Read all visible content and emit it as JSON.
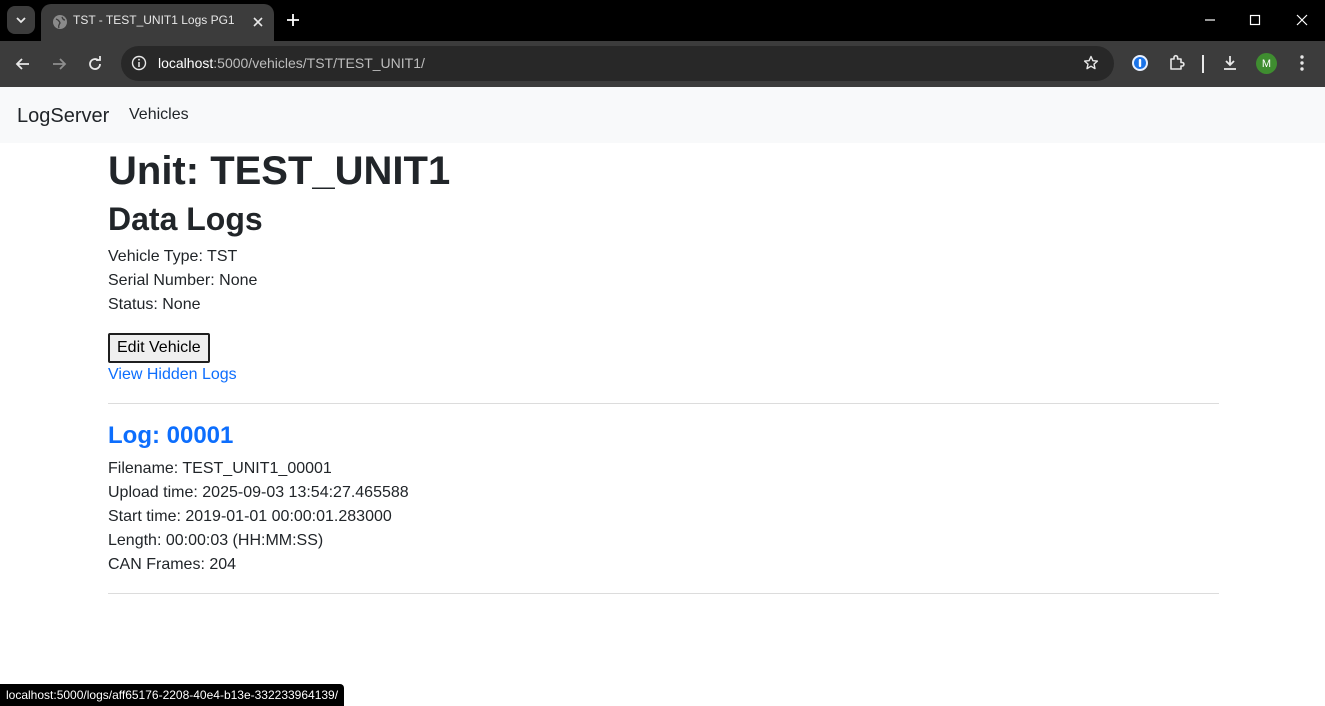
{
  "browser": {
    "tab_title": "TST - TEST_UNIT1 Logs PG1",
    "url_host": "localhost",
    "url_rest": ":5000/vehicles/TST/TEST_UNIT1/",
    "profile_initial": "M"
  },
  "navbar": {
    "brand": "LogServer",
    "vehicles_link": "Vehicles"
  },
  "unit": {
    "heading": "Unit: TEST_UNIT1",
    "subheading": "Data Logs",
    "vehicle_type": "Vehicle Type: TST",
    "serial_number": "Serial Number: None",
    "status": "Status: None",
    "edit_button": "Edit Vehicle",
    "hidden_logs_link": "View Hidden Logs"
  },
  "logs": [
    {
      "title": "Log: 00001",
      "filename": "Filename: TEST_UNIT1_00001",
      "upload_time": "Upload time: 2025-09-03 13:54:27.465588",
      "start_time": "Start time: 2019-01-01 00:00:01.283000",
      "length": "Length: 00:00:03 (HH:MM:SS)",
      "can_frames": "CAN Frames: 204"
    }
  ],
  "status_bar": {
    "url": "localhost:5000/logs/aff65176-2208-40e4-b13e-332233964139/"
  },
  "colors": {
    "link": "#0d6efd",
    "navbar_bg": "#f8f9fa",
    "chrome_bg": "#3c3c3c"
  }
}
